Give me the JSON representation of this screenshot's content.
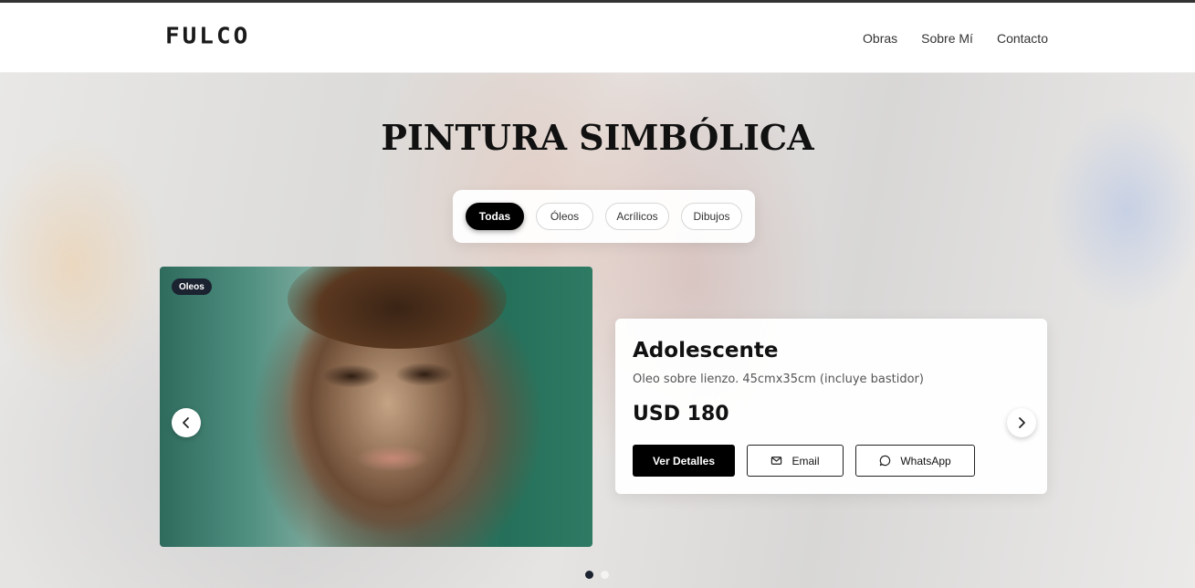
{
  "header": {
    "logo": "FULCO",
    "nav": [
      {
        "label": "Obras"
      },
      {
        "label": "Sobre Mí"
      },
      {
        "label": "Contacto"
      }
    ]
  },
  "main": {
    "title": "PINTURA SIMBÓLICA",
    "filters": [
      {
        "label": "Todas",
        "active": true
      },
      {
        "label": "Óleos",
        "active": false
      },
      {
        "label": "Acrílicos",
        "active": false
      },
      {
        "label": "Dibujos",
        "active": false
      }
    ]
  },
  "carousel": {
    "badge": "Oleos",
    "artwork": {
      "title": "Adolescente",
      "description": "Oleo sobre lienzo. 45cmx35cm (incluye bastidor)",
      "price": "USD 180"
    },
    "buttons": {
      "details": "Ver Detalles",
      "email": "Email",
      "whatsapp": "WhatsApp"
    },
    "slides_total": 2,
    "active_slide": 1
  },
  "icons": {
    "prev": "chevron-left-icon",
    "next": "chevron-right-icon",
    "email": "mail-icon",
    "whatsapp": "chat-bubble-icon"
  }
}
